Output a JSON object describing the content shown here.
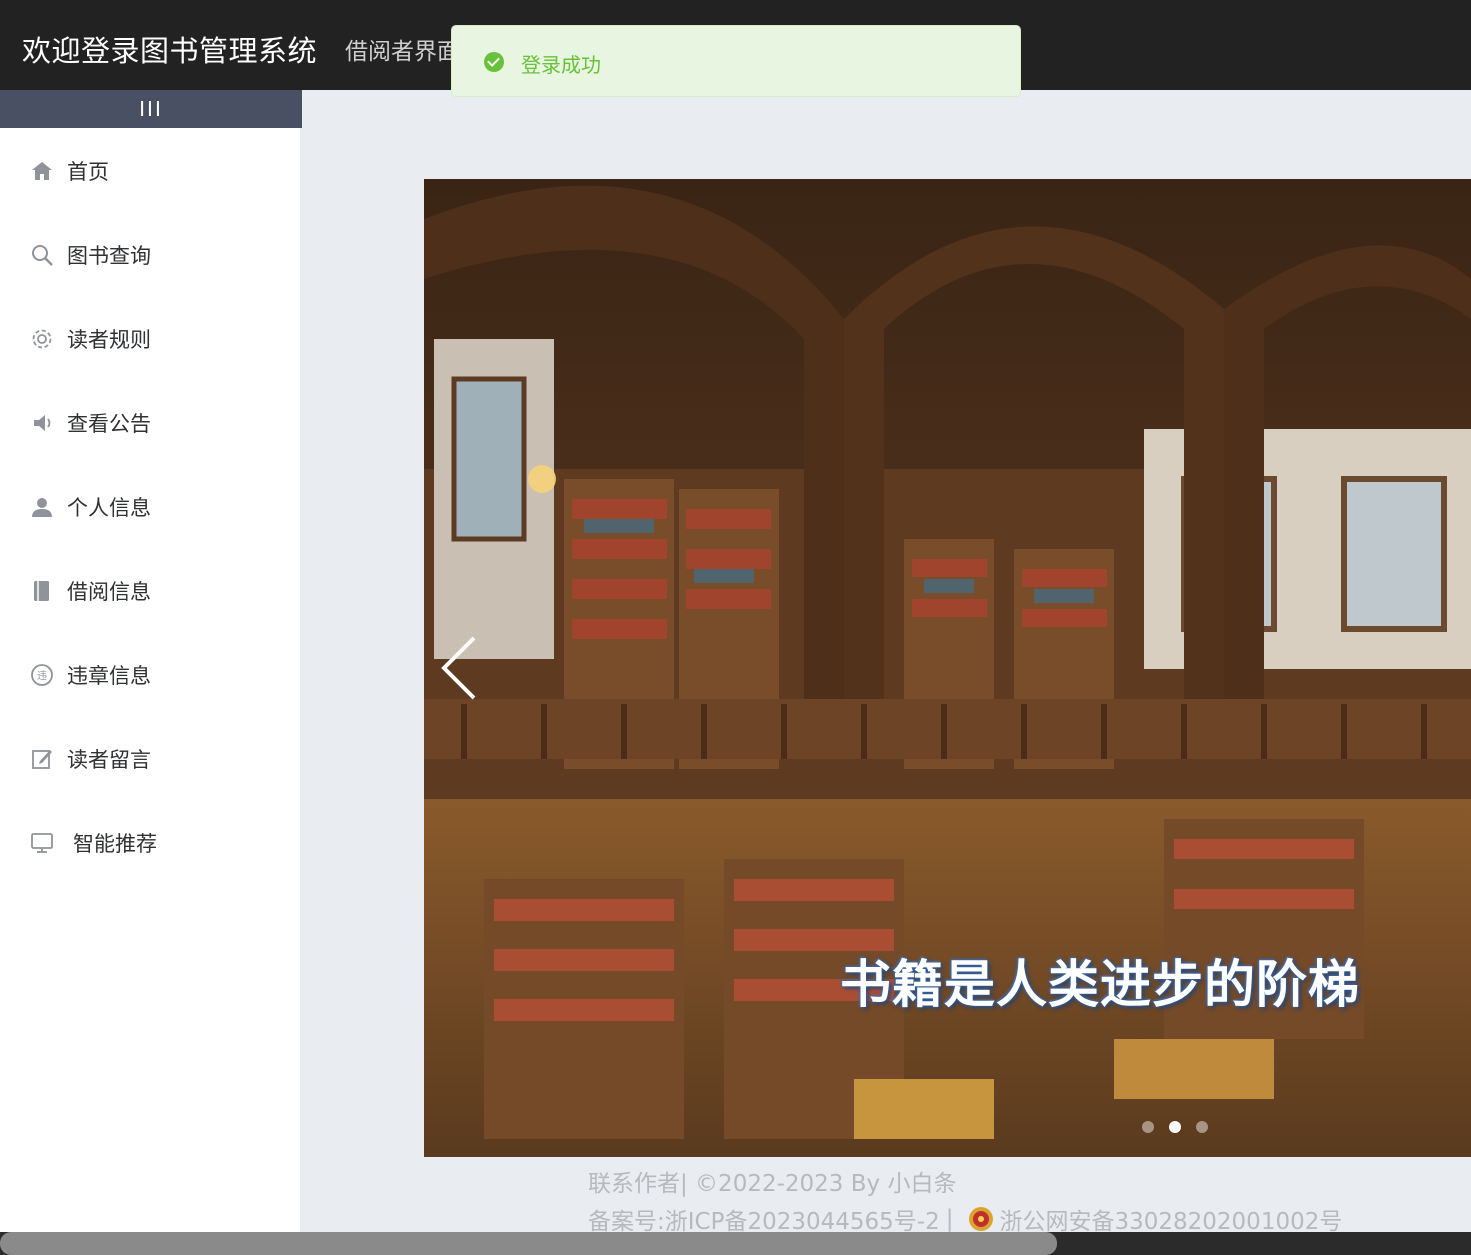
{
  "header": {
    "title": "欢迎登录图书管理系统",
    "subtitle": "借阅者界面"
  },
  "toast": {
    "icon": "success-check-icon",
    "message": "登录成功",
    "color": "#67c23a"
  },
  "sidebar": {
    "collapse_label": "III",
    "items": [
      {
        "icon": "home-icon",
        "label": "首页"
      },
      {
        "icon": "search-icon",
        "label": "图书查询"
      },
      {
        "icon": "settings-gear-icon",
        "label": "读者规则"
      },
      {
        "icon": "speaker-icon",
        "label": "查看公告"
      },
      {
        "icon": "user-icon",
        "label": "个人信息"
      },
      {
        "icon": "book-icon",
        "label": "借阅信息"
      },
      {
        "icon": "violation-icon",
        "label": "违章信息"
      },
      {
        "icon": "edit-icon",
        "label": "读者留言"
      },
      {
        "icon": "monitor-icon",
        "label": "智能推荐"
      }
    ]
  },
  "carousel": {
    "slogan": "书籍是人类进步的阶梯",
    "active_index": 1,
    "slide_count": 3
  },
  "footer": {
    "line1": "联系作者| ©2022-2023 By 小白条",
    "icp": "备案号:浙ICP备2023044565号-2",
    "separator": "|",
    "police": "浙公网安备33028202001002号"
  },
  "colors": {
    "topbar": "#222222",
    "sidebar_toggle": "#4a5064",
    "content_bg": "#e9edf1",
    "footer_text": "#b6b9be"
  }
}
